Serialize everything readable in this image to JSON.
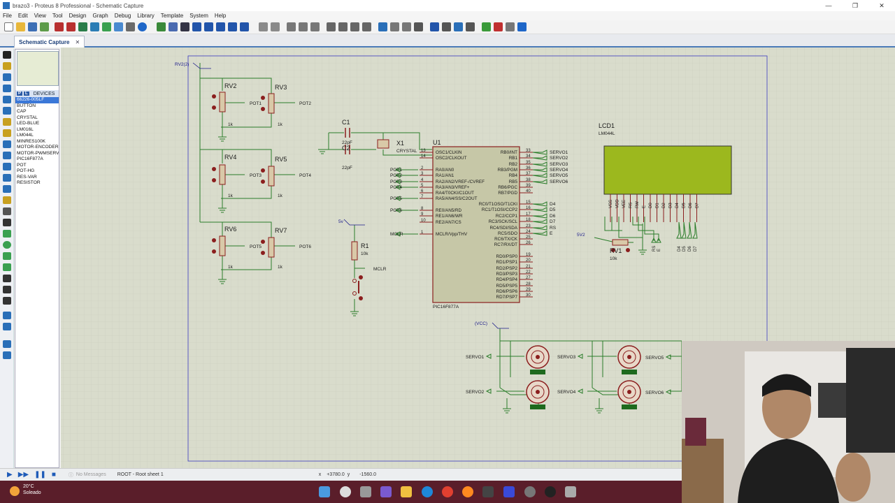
{
  "window": {
    "title": "brazo3 - Proteus 8 Professional - Schematic Capture",
    "controls": [
      "—",
      "❐",
      "✕"
    ]
  },
  "menu": [
    "File",
    "Edit",
    "View",
    "Tool",
    "Design",
    "Graph",
    "Debug",
    "Library",
    "Template",
    "System",
    "Help"
  ],
  "tab": {
    "label": "Schematic Capture",
    "close": "✕"
  },
  "devices": {
    "header": "DEVICES",
    "mode_p": "P",
    "mode_l": "L",
    "items": [
      "66226-005LF",
      "BUTTON",
      "CAP",
      "CRYSTAL",
      "LED-BLUE",
      "LM016L",
      "LM044L",
      "MINRES100K",
      "MOTOR-ENCODER",
      "MOTOR-PWMSERVO",
      "PIC16F877A",
      "POT",
      "POT-HG",
      "RES-VAR",
      "RESISTOR"
    ],
    "selected": 0
  },
  "schematic": {
    "rv_top_label": "RV2(2)",
    "pots": [
      {
        "ref": "RV2",
        "val": "1k",
        "out": "POT1"
      },
      {
        "ref": "RV3",
        "val": "1k",
        "out": "POT2"
      },
      {
        "ref": "RV4",
        "val": "1k",
        "out": "POT3"
      },
      {
        "ref": "RV5",
        "val": "1k",
        "out": "POT4"
      },
      {
        "ref": "RV6",
        "val": "1k",
        "out": "POT5"
      },
      {
        "ref": "RV7",
        "val": "1k",
        "out": "POT6"
      }
    ],
    "c1": {
      "ref": "C1",
      "val": "22pF"
    },
    "c2": {
      "ref": "C2",
      "val": "22pF"
    },
    "x1": {
      "ref": "X1",
      "val": "CRYSTAL"
    },
    "u1": {
      "ref": "U1",
      "part": "PIC16F877A"
    },
    "left_pins": [
      {
        "num": "13",
        "name": "OSC1/CLKIN",
        "net": ""
      },
      {
        "num": "14",
        "name": "OSC2/CLKOUT",
        "net": ""
      },
      {
        "num": "2",
        "name": "RA0/AN0",
        "net": "POT1"
      },
      {
        "num": "3",
        "name": "RA1/AN1",
        "net": "POT2"
      },
      {
        "num": "4",
        "name": "RA2/AN2/VREF-/CVREF",
        "net": "POT3"
      },
      {
        "num": "5",
        "name": "RA3/AN3/VREF+",
        "net": "POT4"
      },
      {
        "num": "6",
        "name": "RA4/T0CKI/C1OUT",
        "net": ""
      },
      {
        "num": "7",
        "name": "RA5/AN4/SS/C2OUT",
        "net": "POT5"
      },
      {
        "num": "8",
        "name": "RE0/AN5/RD",
        "net": "POT6"
      },
      {
        "num": "9",
        "name": "RE1/AN6/WR",
        "net": ""
      },
      {
        "num": "10",
        "name": "RE2/AN7/CS",
        "net": ""
      },
      {
        "num": "1",
        "name": "MCLR/Vpp/THV",
        "net": "MCLR"
      }
    ],
    "right_pins": [
      {
        "num": "33",
        "name": "RB0/INT",
        "net": "SERVO1"
      },
      {
        "num": "34",
        "name": "RB1",
        "net": "SERVO2"
      },
      {
        "num": "35",
        "name": "RB2",
        "net": "SERVO3"
      },
      {
        "num": "36",
        "name": "RB3/PGM",
        "net": "SERVO4"
      },
      {
        "num": "37",
        "name": "RB4",
        "net": "SERVO5"
      },
      {
        "num": "38",
        "name": "RB5",
        "net": "SERVO6"
      },
      {
        "num": "39",
        "name": "RB6/PGC",
        "net": ""
      },
      {
        "num": "40",
        "name": "RB7/PGD",
        "net": ""
      },
      {
        "num": "15",
        "name": "RC0/T1OSO/T1CKI",
        "net": "D4"
      },
      {
        "num": "16",
        "name": "RC1/T1OSI/CCP2",
        "net": "D5"
      },
      {
        "num": "17",
        "name": "RC2/CCP1",
        "net": "D6"
      },
      {
        "num": "18",
        "name": "RC3/SCK/SCL",
        "net": "D7"
      },
      {
        "num": "23",
        "name": "RC4/SDI/SDA",
        "net": "RS"
      },
      {
        "num": "24",
        "name": "RC5/SDO",
        "net": "E"
      },
      {
        "num": "25",
        "name": "RC6/TX/CK",
        "net": ""
      },
      {
        "num": "26",
        "name": "RC7/RX/DT",
        "net": ""
      },
      {
        "num": "19",
        "name": "RD0/PSP0",
        "net": ""
      },
      {
        "num": "20",
        "name": "RD1/PSP1",
        "net": ""
      },
      {
        "num": "21",
        "name": "RD2/PSP2",
        "net": ""
      },
      {
        "num": "22",
        "name": "RD3/PSP3",
        "net": ""
      },
      {
        "num": "27",
        "name": "RD4/PSP4",
        "net": ""
      },
      {
        "num": "28",
        "name": "RD5/PSP5",
        "net": ""
      },
      {
        "num": "29",
        "name": "RD6/PSP6",
        "net": ""
      },
      {
        "num": "30",
        "name": "RD7/PSP7",
        "net": ""
      }
    ],
    "r1": {
      "ref": "R1",
      "val": "10k",
      "supply": "5v",
      "net": "MCLR"
    },
    "lcd": {
      "ref": "LCD1",
      "part": "LM044L",
      "pins": [
        "VSS",
        "VDD",
        "VEE",
        "RS",
        "RW",
        "E",
        "D0",
        "D1",
        "D2",
        "D3",
        "D4",
        "D5",
        "D6",
        "D7"
      ],
      "bottom_labels": [
        "RS",
        "E",
        "D4",
        "D5",
        "D6",
        "D7"
      ]
    },
    "rv1": {
      "ref": "RV1",
      "val": "10k",
      "supply": "5V2"
    },
    "vcc": "(VCC)",
    "servos": [
      {
        "net": "SERVO1"
      },
      {
        "net": "SERVO2"
      },
      {
        "net": "SERVO3"
      },
      {
        "net": "SERVO4"
      },
      {
        "net": "SERVO5"
      },
      {
        "net": "SERVO6"
      }
    ]
  },
  "status": {
    "messages": "No Messages",
    "sheet": "ROOT - Root sheet 1",
    "x_label": "x",
    "x_val": "+3780.0",
    "y_label": "y",
    "y_val": "-1560.0"
  },
  "weather": {
    "temp": "20°C",
    "desc": "Soleado"
  },
  "colors": {
    "wire": "#2a7d2a",
    "component": "#8b1e1e",
    "chip_fill": "#c6c7a7",
    "lcd_fill": "#9cb81e",
    "canvas": "#d9dccc",
    "net_label": "#1a1a8a"
  }
}
